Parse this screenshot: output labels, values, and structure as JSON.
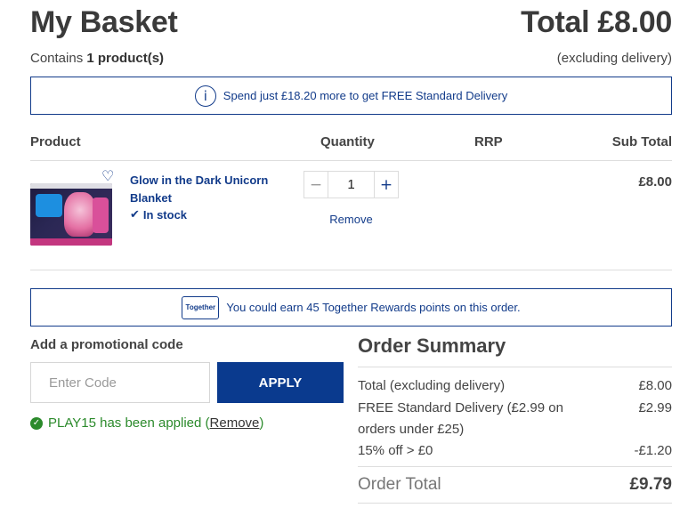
{
  "header": {
    "title": "My Basket",
    "total": "Total £8.00",
    "contains_prefix": "Contains",
    "contains_count": "1 product(s)",
    "excluding_delivery": "(excluding delivery)"
  },
  "delivery_banner": {
    "icon": "info-icon",
    "text": "Spend just £18.20 more to get FREE Standard Delivery"
  },
  "table": {
    "columns": [
      "Product",
      "Quantity",
      "RRP",
      "Sub Total"
    ]
  },
  "items": [
    {
      "name": "Glow in the Dark Unicorn Blanket",
      "stock": "In stock",
      "quantity": "1",
      "rrp": "",
      "subtotal": "£8.00",
      "remove_label": "Remove",
      "minus_label": "−",
      "plus_label": "+",
      "wishlist_icon": "heart-icon",
      "check_icon": "check-icon"
    }
  ],
  "rewards": {
    "logo_text": "Together",
    "text": "You could earn 45 Together Rewards points on this order."
  },
  "promo": {
    "title": "Add a promotional code",
    "placeholder": "Enter Code",
    "value": "",
    "apply_label": "APPLY",
    "applied_text": "PLAY15 has been applied (",
    "remove_label": "Remove",
    "applied_suffix": ")"
  },
  "summary": {
    "title": "Order Summary",
    "lines": [
      {
        "label": "Total (excluding delivery)",
        "value": "£8.00"
      },
      {
        "label": "FREE Standard Delivery (£2.99 on orders under £25)",
        "value": "£2.99"
      },
      {
        "label": "15% off > £0",
        "value": "-£1.20"
      }
    ],
    "order_total_label": "Order Total",
    "order_total_value": "£9.79"
  },
  "colors": {
    "brand_blue": "#123b8a",
    "apply_button": "#0a3a8e",
    "success_green": "#2b8a2b"
  }
}
